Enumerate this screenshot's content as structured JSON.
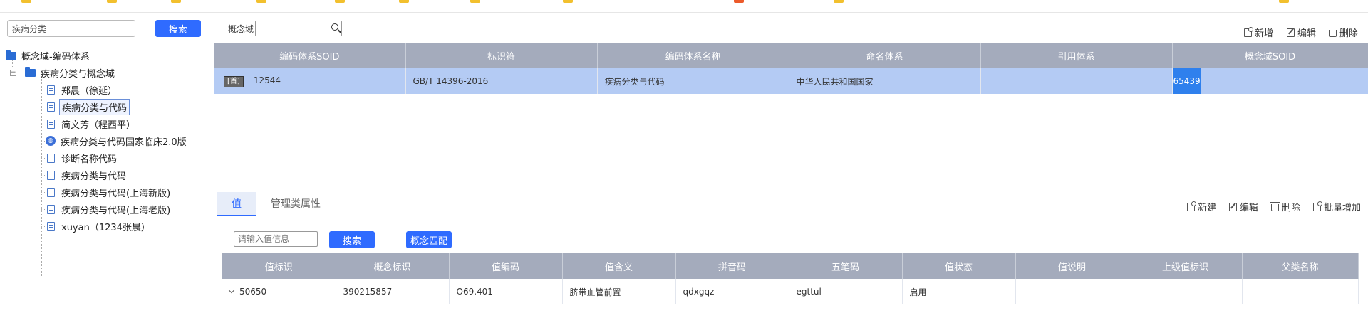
{
  "tree": {
    "search_value": "疾病分类",
    "search_button": "搜索",
    "root_label": "概念域-编码体系",
    "group_label": "疾病分类与概念域",
    "items": [
      {
        "label": "郑晨（徐延）",
        "icon": "document-icon"
      },
      {
        "label": "疾病分类与代码",
        "icon": "document-icon",
        "selected": true
      },
      {
        "label": "简文芳（程西平）",
        "icon": "document-icon"
      },
      {
        "label": "疾病分类与代码国家临床2.0版",
        "icon": "globe-icon"
      },
      {
        "label": "诊断名称代码",
        "icon": "document-icon"
      },
      {
        "label": "疾病分类与代码",
        "icon": "document-icon"
      },
      {
        "label": "疾病分类与代码(上海新版)",
        "icon": "document-icon"
      },
      {
        "label": "疾病分类与代码(上海老版)",
        "icon": "document-icon"
      },
      {
        "label": "xuyan（1234张晨）",
        "icon": "document-icon"
      }
    ]
  },
  "top": {
    "domain_label": "概念域",
    "domain_value": "",
    "toolbar": {
      "add": "新增",
      "edit": "编辑",
      "delete": "删除"
    },
    "columns": [
      "编码体系SOID",
      "标识符",
      "编码体系名称",
      "命名体系",
      "引用体系",
      "概念域SOID"
    ],
    "row": {
      "tag": "[首]",
      "soid": "12544",
      "identifier": "GB/T 14396-2016",
      "name": "疾病分类与代码",
      "naming": "中华人民共和国国家",
      "reference": "",
      "domain_soid": "65439"
    }
  },
  "bottom": {
    "tabs": [
      "值",
      "管理类属性"
    ],
    "active_tab": "值",
    "toolbar": {
      "new": "新建",
      "edit": "编辑",
      "delete": "删除",
      "batch_add": "批量增加"
    },
    "value_placeholder": "请输入值信息",
    "search_button": "搜索",
    "match_button": "概念匹配",
    "columns": [
      "值标识",
      "概念标识",
      "值编码",
      "值含义",
      "拼音码",
      "五笔码",
      "值状态",
      "值说明",
      "上级值标识",
      "父类名称"
    ],
    "rows": [
      {
        "value_id": "50650",
        "concept_id": "390215857",
        "code": "O69.401",
        "meaning": "脐带血管前置",
        "pinyin": "qdxgqz",
        "wubi": "egttul",
        "status": "启用",
        "desc": "",
        "parent_id": "",
        "parent_name": ""
      }
    ]
  },
  "colors": {
    "accent": "#2f6bff",
    "header": "#a4abbc",
    "selected_row": "#b4cbf4",
    "highlight_cell": "#2f80ed"
  }
}
